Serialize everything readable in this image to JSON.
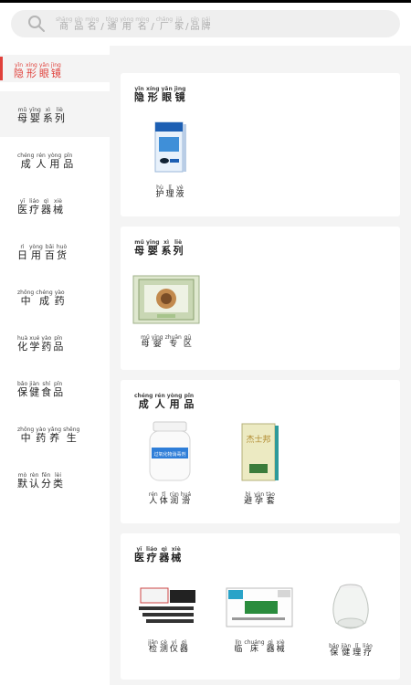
{
  "search": {
    "placeholder_chars": [
      {
        "py": "shāng",
        "hz": "商"
      },
      {
        "py": "pǐn",
        "hz": "品"
      },
      {
        "py": "míng",
        "hz": "名"
      },
      {
        "py": "",
        "hz": "/"
      },
      {
        "py": "tōng",
        "hz": "通"
      },
      {
        "py": "yòng",
        "hz": "用"
      },
      {
        "py": "míng",
        "hz": "名"
      },
      {
        "py": "",
        "hz": "/"
      },
      {
        "py": "chǎng",
        "hz": "厂"
      },
      {
        "py": "jiā",
        "hz": "家"
      },
      {
        "py": "",
        "hz": "/"
      },
      {
        "py": "pǐn",
        "hz": "品"
      },
      {
        "py": "pái",
        "hz": "牌"
      }
    ]
  },
  "sidebar": {
    "active": {
      "label": [
        {
          "py": "yǐn",
          "hz": "隐"
        },
        {
          "py": "xíng",
          "hz": "形"
        },
        {
          "py": "yǎn",
          "hz": "眼"
        },
        {
          "py": "jìng",
          "hz": "镜"
        }
      ]
    },
    "items": [
      [
        {
          "py": "mǔ",
          "hz": "母"
        },
        {
          "py": "yīng",
          "hz": "婴"
        },
        {
          "py": "xì",
          "hz": "系"
        },
        {
          "py": "liè",
          "hz": "列"
        }
      ],
      [
        {
          "py": "chéng",
          "hz": "成"
        },
        {
          "py": "rén",
          "hz": "人"
        },
        {
          "py": "yòng",
          "hz": "用"
        },
        {
          "py": "pǐn",
          "hz": "品"
        }
      ],
      [
        {
          "py": "yī",
          "hz": "医"
        },
        {
          "py": "liáo",
          "hz": "疗"
        },
        {
          "py": "qì",
          "hz": "器"
        },
        {
          "py": "xiè",
          "hz": "械"
        }
      ],
      [
        {
          "py": "rì",
          "hz": "日"
        },
        {
          "py": "yòng",
          "hz": "用"
        },
        {
          "py": "bǎi",
          "hz": "百"
        },
        {
          "py": "huò",
          "hz": "货"
        }
      ],
      [
        {
          "py": "zhōng",
          "hz": "中"
        },
        {
          "py": "chéng",
          "hz": "成"
        },
        {
          "py": "yào",
          "hz": "药"
        }
      ],
      [
        {
          "py": "huà",
          "hz": "化"
        },
        {
          "py": "xué",
          "hz": "学"
        },
        {
          "py": "yào",
          "hz": "药"
        },
        {
          "py": "pǐn",
          "hz": "品"
        }
      ],
      [
        {
          "py": "bǎo",
          "hz": "保"
        },
        {
          "py": "jiàn",
          "hz": "健"
        },
        {
          "py": "shí",
          "hz": "食"
        },
        {
          "py": "pǐn",
          "hz": "品"
        }
      ],
      [
        {
          "py": "zhōng",
          "hz": "中"
        },
        {
          "py": "yào",
          "hz": "药"
        },
        {
          "py": "yǎng",
          "hz": "养"
        },
        {
          "py": "shēng",
          "hz": "生"
        }
      ],
      [
        {
          "py": "mò",
          "hz": "默"
        },
        {
          "py": "rèn",
          "hz": "认"
        },
        {
          "py": "fēn",
          "hz": "分"
        },
        {
          "py": "lèi",
          "hz": "类"
        }
      ]
    ]
  },
  "sections": [
    {
      "title": [
        {
          "py": "yǐn",
          "hz": "隐"
        },
        {
          "py": "xíng",
          "hz": "形"
        },
        {
          "py": "yǎn",
          "hz": "眼"
        },
        {
          "py": "jìng",
          "hz": "镜"
        }
      ],
      "products": [
        {
          "name": [
            {
              "py": "hù",
              "hz": "护"
            },
            {
              "py": "lǐ",
              "hz": "理"
            },
            {
              "py": "yè",
              "hz": "液"
            }
          ],
          "image": "contact-lens-solution-box"
        }
      ]
    },
    {
      "title": [
        {
          "py": "mǔ",
          "hz": "母"
        },
        {
          "py": "yīng",
          "hz": "婴"
        },
        {
          "py": "xì",
          "hz": "系"
        },
        {
          "py": "liè",
          "hz": "列"
        }
      ],
      "products": [
        {
          "name": [
            {
              "py": "mǔ",
              "hz": "母"
            },
            {
              "py": "yīng",
              "hz": "婴"
            },
            {
              "py": "zhuān",
              "hz": "专"
            },
            {
              "py": "qū",
              "hz": "区"
            }
          ],
          "image": "baby-product-box"
        }
      ]
    },
    {
      "title": [
        {
          "py": "chéng",
          "hz": "成"
        },
        {
          "py": "rén",
          "hz": "人"
        },
        {
          "py": "yòng",
          "hz": "用"
        },
        {
          "py": "pǐn",
          "hz": "品"
        }
      ],
      "products": [
        {
          "name": [
            {
              "py": "rén",
              "hz": "人"
            },
            {
              "py": "tǐ",
              "hz": "体"
            },
            {
              "py": "rùn",
              "hz": "润"
            },
            {
              "py": "huá",
              "hz": "滑"
            }
          ],
          "image": "lubricant-bottle",
          "label_text": "过氧化物消毒剂"
        },
        {
          "name": [
            {
              "py": "bì",
              "hz": "避"
            },
            {
              "py": "yùn",
              "hz": "孕"
            },
            {
              "py": "tào",
              "hz": "套"
            }
          ],
          "image": "condom-box",
          "label_text": "杰士邦"
        }
      ]
    },
    {
      "title": [
        {
          "py": "yī",
          "hz": "医"
        },
        {
          "py": "liáo",
          "hz": "疗"
        },
        {
          "py": "qì",
          "hz": "器"
        },
        {
          "py": "xiè",
          "hz": "械"
        }
      ],
      "products": [
        {
          "name": [
            {
              "py": "jiǎn",
              "hz": "检"
            },
            {
              "py": "cè",
              "hz": "测"
            },
            {
              "py": "yí",
              "hz": "仪"
            },
            {
              "py": "qì",
              "hz": "器"
            }
          ],
          "image": "test-strips"
        },
        {
          "name": [
            {
              "py": "lín",
              "hz": "临"
            },
            {
              "py": "chuáng",
              "hz": "床"
            },
            {
              "py": "qì",
              "hz": "器"
            },
            {
              "py": "xiè",
              "hz": "械"
            }
          ],
          "image": "clinical-box"
        },
        {
          "name": [
            {
              "py": "bǎo",
              "hz": "保"
            },
            {
              "py": "jiàn",
              "hz": "健"
            },
            {
              "py": "lǐ",
              "hz": "理"
            },
            {
              "py": "liáo",
              "hz": "疗"
            }
          ],
          "image": "cupping-glass"
        }
      ]
    }
  ],
  "colors": {
    "accent": "#e0413b",
    "background": "#f4f4f4"
  }
}
